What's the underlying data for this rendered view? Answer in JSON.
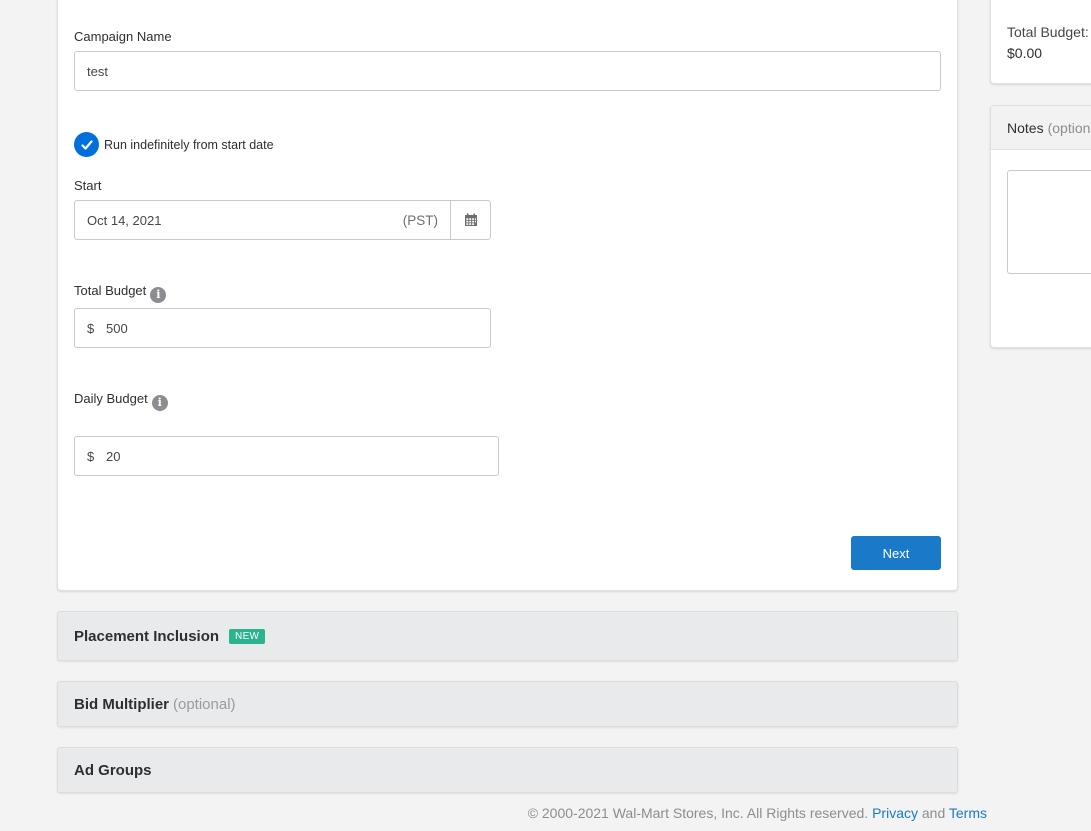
{
  "campaign_form": {
    "campaign_name_label": "Campaign Name",
    "campaign_name_value": "test",
    "run_indefinitely_label": "Run indefinitely from start date",
    "run_indefinitely_checked": true,
    "start_label": "Start",
    "start_date_value": "Oct 14, 2021",
    "timezone": "(PST)",
    "total_budget_label": "Total Budget",
    "total_budget_currency": "$",
    "total_budget_value": "500",
    "daily_budget_label": "Daily Budget",
    "daily_budget_currency": "$",
    "daily_budget_value": "20",
    "next_label": "Next"
  },
  "sections": {
    "placement_inclusion": "Placement Inclusion",
    "placement_badge": "NEW",
    "bid_multiplier": "Bid Multiplier",
    "bid_multiplier_optional": "(optional)",
    "ad_groups": "Ad Groups"
  },
  "sidebar": {
    "total_budget_label": "Total Budget:",
    "total_budget_value": "$0.00",
    "notes_label": "Notes",
    "notes_optional": "(optional)"
  },
  "footer": {
    "copyright": "© 2000-2021 Wal-Mart Stores, Inc. All Rights reserved.",
    "privacy_link": "Privacy",
    "and_text": "and",
    "terms_link": "Terms"
  },
  "colors": {
    "accent_blue": "#1a7ac9",
    "new_badge": "#2bb38f",
    "background": "#f3f3f3"
  }
}
